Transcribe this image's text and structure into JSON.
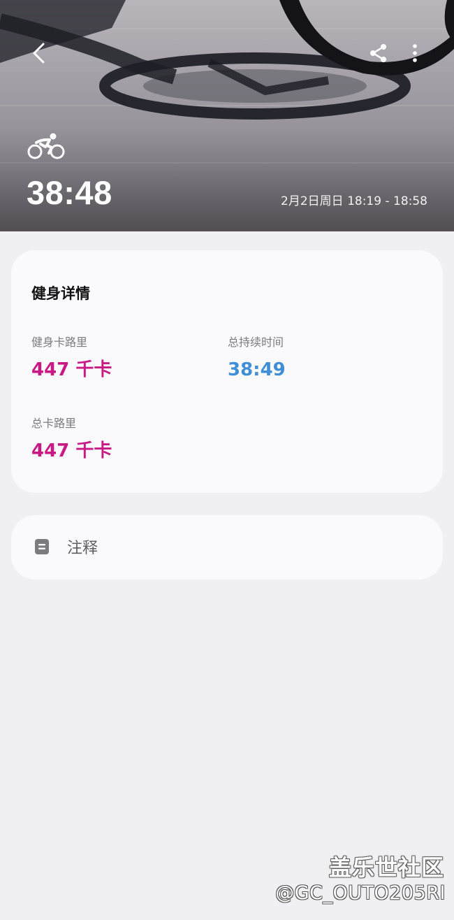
{
  "hero": {
    "activity_icon": "cycling-icon",
    "duration": "38:48",
    "datetime": "2月2日周日 18:19 - 18:58"
  },
  "toolbar": {
    "back_icon": "chevron-left-icon",
    "share_icon": "share-icon",
    "more_icon": "more-vertical-icon"
  },
  "details": {
    "title": "健身详情",
    "metrics": [
      {
        "label": "健身卡路里",
        "value": "447 千卡",
        "color": "#c81a84"
      },
      {
        "label": "总持续时间",
        "value": "38:49",
        "color": "#3f8fd8"
      },
      {
        "label": "总卡路里",
        "value": "447 千卡",
        "color": "#c81a84"
      }
    ]
  },
  "notes": {
    "icon": "note-icon",
    "label": "注释"
  },
  "watermark": {
    "site": "盖乐世社区",
    "user": "@GC_OUTO205RI"
  }
}
